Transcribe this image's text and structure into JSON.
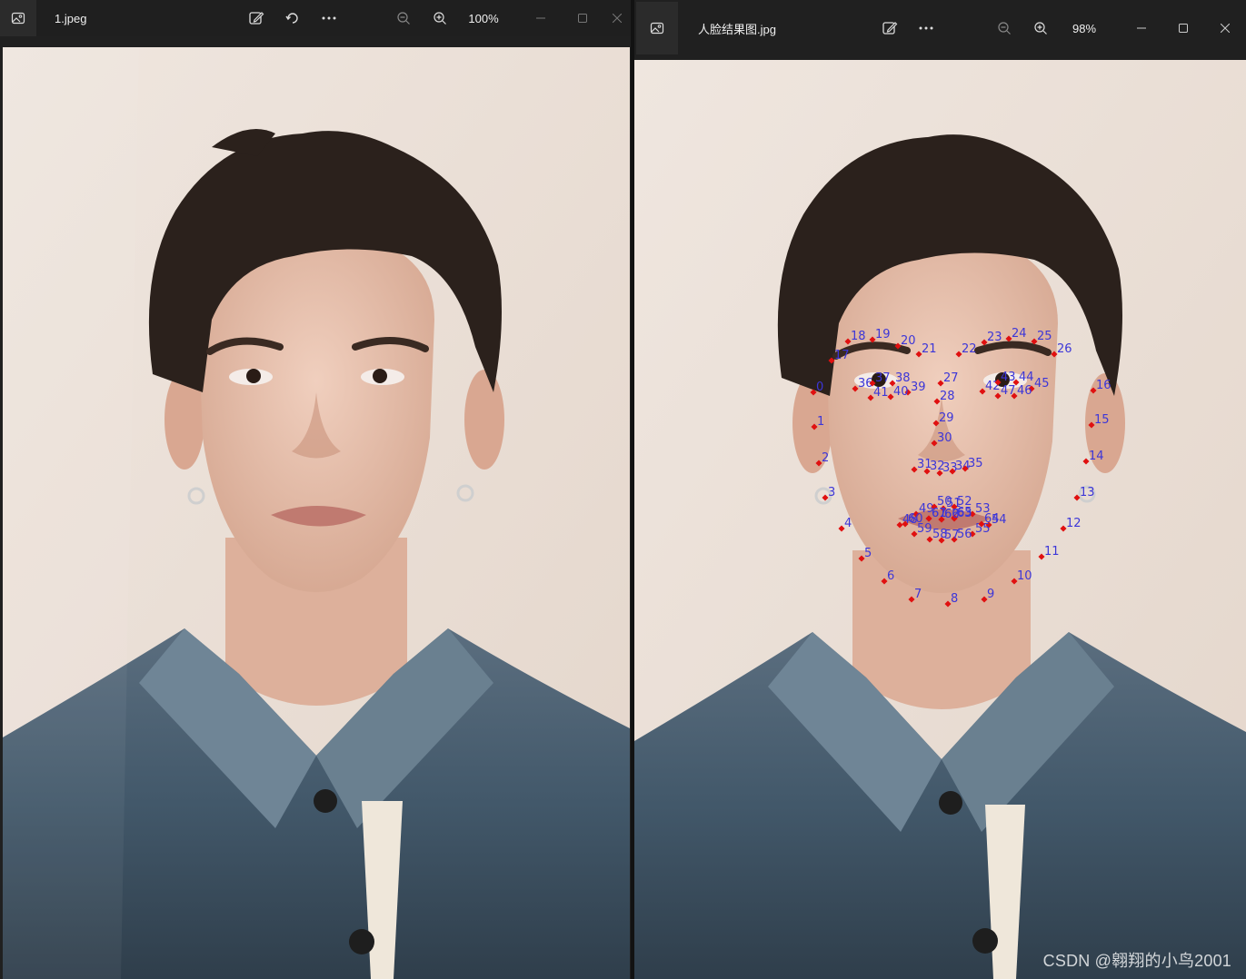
{
  "left_window": {
    "file_name": "1.jpeg",
    "zoom": "100%",
    "icons": [
      "image-icon",
      "edit-icon",
      "rotate-icon",
      "more-icon",
      "zoom-out-icon",
      "zoom-in-icon",
      "minimize-icon",
      "maximize-icon",
      "close-icon"
    ]
  },
  "right_window": {
    "file_name": "人脸结果图.jpg",
    "zoom": "98%",
    "icons": [
      "image-icon",
      "edit-icon",
      "more-icon",
      "zoom-out-icon",
      "zoom-in-icon",
      "minimize-icon",
      "maximize-icon",
      "close-icon"
    ]
  },
  "landmark_labels": [
    "0",
    "1",
    "2",
    "3",
    "4",
    "5",
    "6",
    "7",
    "8",
    "9",
    "10",
    "11",
    "12",
    "13",
    "14",
    "15",
    "16",
    "17",
    "18",
    "19",
    "20",
    "21",
    "22",
    "23",
    "24",
    "25",
    "26",
    "27",
    "28",
    "29",
    "30",
    "31",
    "32",
    "33",
    "34",
    "35",
    "36",
    "37",
    "38",
    "39",
    "40",
    "41",
    "42",
    "43",
    "44",
    "45",
    "46",
    "47",
    "48",
    "49",
    "50",
    "51",
    "52",
    "53",
    "54",
    "55",
    "56",
    "57",
    "58",
    "59",
    "60",
    "61",
    "62",
    "63",
    "64",
    "65",
    "66",
    "67"
  ],
  "watermark": "CSDN @翱翔的小鸟2001",
  "colors": {
    "titlebar_bg": "#202020",
    "landmark_dot": "#e01010",
    "landmark_label": "#3c36d8"
  }
}
